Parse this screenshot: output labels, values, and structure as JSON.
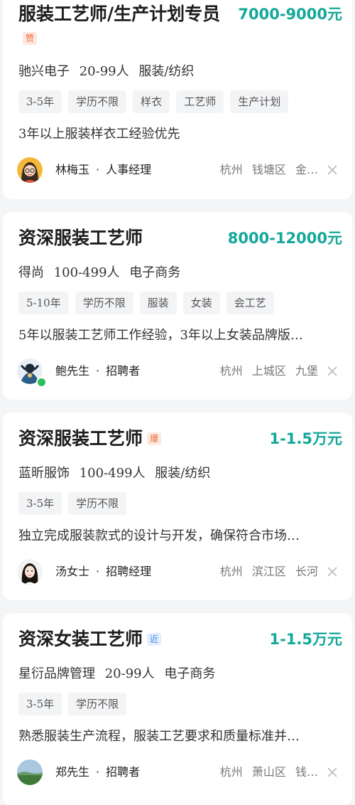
{
  "jobs": [
    {
      "title": "服装工艺师/生产计划专员",
      "badge": "赞",
      "badge_color": "orange",
      "salary": "7000-9000元",
      "company": "驰兴电子",
      "size": "20-99人",
      "industry": "服装/纺织",
      "tags": [
        "3-5年",
        "学历不限",
        "样衣",
        "工艺师",
        "生产计划"
      ],
      "description": "3年以上服装样衣工经验优先",
      "recruiter_name": "林梅玉",
      "recruiter_role": "人事经理",
      "city": "杭州",
      "district": "钱塘区",
      "area": "金…",
      "avatar": "woman-glasses-avatar",
      "online": false
    },
    {
      "title": "资深服装工艺师",
      "badge": "",
      "salary": "8000-12000元",
      "company": "得尚",
      "size": "100-499人",
      "industry": "电子商务",
      "tags": [
        "5-10年",
        "学历不限",
        "服装",
        "女装",
        "会工艺"
      ],
      "description": "5年以服装工艺师工作经验，3年以上女装品牌版…",
      "recruiter_name": "鲍先生",
      "recruiter_role": "招聘者",
      "city": "杭州",
      "district": "上城区",
      "area": "九堡",
      "avatar": "cartoon-avatar",
      "online": true
    },
    {
      "title": "资深服装工艺师",
      "badge": "爆",
      "badge_color": "orange",
      "salary": "1-1.5万元",
      "company": "蓝昕服饰",
      "size": "100-499人",
      "industry": "服装/纺织",
      "tags": [
        "3-5年",
        "学历不限"
      ],
      "description": "独立完成服装款式的设计与开发，确保符合市场…",
      "recruiter_name": "汤女士",
      "recruiter_role": "招聘经理",
      "city": "杭州",
      "district": "滨江区",
      "area": "长河",
      "avatar": "woman-portrait-avatar",
      "online": false
    },
    {
      "title": "资深女装工艺师",
      "badge": "近",
      "badge_color": "blue",
      "salary": "1-1.5万元",
      "company": "星衍品牌管理",
      "size": "20-99人",
      "industry": "电子商务",
      "tags": [
        "3-5年",
        "学历不限"
      ],
      "description": "熟悉服装生产流程，服装工艺要求和质量标准并…",
      "recruiter_name": "郑先生",
      "recruiter_role": "招聘者",
      "city": "杭州",
      "district": "萧山区",
      "area": "钱…",
      "avatar": "landscape-avatar",
      "online": false
    }
  ],
  "separator": "·"
}
